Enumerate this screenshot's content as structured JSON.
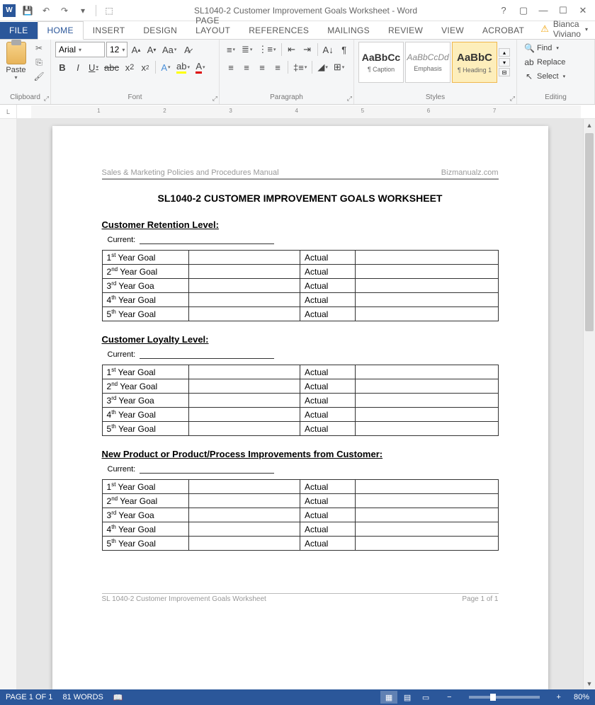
{
  "titlebar": {
    "title": "SL1040-2 Customer Improvement Goals Worksheet - Word"
  },
  "tabs": {
    "file": "FILE",
    "home": "HOME",
    "insert": "INSERT",
    "design": "DESIGN",
    "page_layout": "PAGE LAYOUT",
    "references": "REFERENCES",
    "mailings": "MAILINGS",
    "review": "REVIEW",
    "view": "VIEW",
    "acrobat": "ACROBAT"
  },
  "user": {
    "name": "Bianca Viviano"
  },
  "ribbon": {
    "clipboard": {
      "paste": "Paste",
      "label": "Clipboard"
    },
    "font": {
      "name": "Arial",
      "size": "12",
      "label": "Font"
    },
    "paragraph": {
      "label": "Paragraph"
    },
    "styles": {
      "label": "Styles",
      "items": [
        {
          "preview": "AaBbCc",
          "name": "¶ Caption"
        },
        {
          "preview": "AaBbCcDd",
          "name": "Emphasis"
        },
        {
          "preview": "AaBbC",
          "name": "¶ Heading 1"
        }
      ]
    },
    "editing": {
      "find": "Find",
      "replace": "Replace",
      "select": "Select",
      "label": "Editing"
    }
  },
  "document": {
    "header_left": "Sales & Marketing Policies and Procedures Manual",
    "header_right": "Bizmanualz.com",
    "title": "SL1040-2 CUSTOMER IMPROVEMENT GOALS WORKSHEET",
    "sections": [
      {
        "heading": "Customer Retention Level:"
      },
      {
        "heading": "Customer Loyalty Level:"
      },
      {
        "heading": "New Product or Product/Process Improvements from Customer:"
      }
    ],
    "current_label": "Current:",
    "goal_rows": [
      {
        "goal": "1st Year Goal",
        "actual": "Actual"
      },
      {
        "goal": "2nd Year Goal",
        "actual": "Actual"
      },
      {
        "goal": "3rd Year Goa",
        "actual": "Actual"
      },
      {
        "goal": "4th Year Goal",
        "actual": "Actual"
      },
      {
        "goal": "5th Year Goal",
        "actual": "Actual"
      }
    ],
    "footer_left": "SL 1040-2 Customer Improvement Goals Worksheet",
    "footer_right": "Page 1 of 1"
  },
  "statusbar": {
    "page": "PAGE 1 OF 1",
    "words": "81 WORDS",
    "zoom": "80%"
  }
}
